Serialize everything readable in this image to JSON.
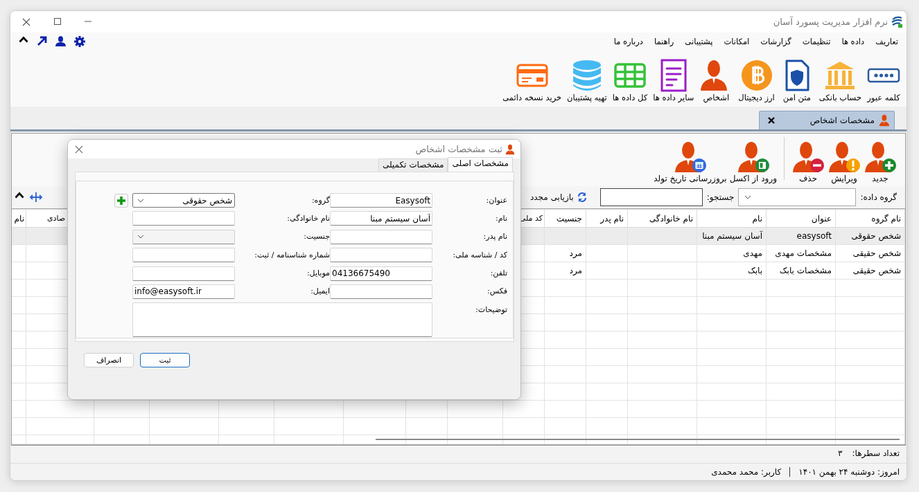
{
  "window": {
    "title": "نرم افزار مدیریت پسورد آسان"
  },
  "menu": [
    "تعاریف",
    "داده ها",
    "تنظیمات",
    "گزارشات",
    "امکانات",
    "پشتیبانی",
    "راهنما",
    "درباره ما"
  ],
  "ribbon": [
    {
      "label": "کلمه عبور",
      "kind": "password"
    },
    {
      "label": "حساب بانکی",
      "kind": "bank"
    },
    {
      "label": "متن امن",
      "kind": "secure"
    },
    {
      "label": "ارز دیجیتال",
      "kind": "coin"
    },
    {
      "label": "اشخاص",
      "kind": "person"
    },
    {
      "label": "سایر داده ها",
      "kind": "document"
    },
    {
      "label": "کل داده ها",
      "kind": "table"
    },
    {
      "label": "تهیه پشتیبان",
      "kind": "database"
    },
    {
      "label": "خرید نسخه دائمی",
      "kind": "card"
    }
  ],
  "document_tabs": [
    {
      "label": "مشخصات اشخاص",
      "selected": true
    }
  ],
  "toolbar": {
    "groups": [
      {
        "buttons": [
          {
            "label": "جدید",
            "kind": "add"
          },
          {
            "label": "ویرایش",
            "kind": "edit"
          },
          {
            "label": "حذف",
            "kind": "delete"
          }
        ]
      },
      {
        "buttons": [
          {
            "label": "ورود از اکسل",
            "kind": "excel"
          },
          {
            "label": "بروزرسانی تاریخ تولد",
            "kind": "calendar"
          }
        ]
      }
    ]
  },
  "filter": {
    "group_label": "گروه داده:",
    "search_label": "جستجو:",
    "refresh_button": "بازیابی مجدد"
  },
  "table": {
    "columns": [
      "نام گروه",
      "عنوان",
      "نام",
      "نام خانوادگی",
      "نام پدر",
      "جنسیت",
      "کد ملی",
      "صادی",
      "نام"
    ],
    "rows": [
      {
        "group": "شخص حقوقی",
        "title": "easysoft",
        "name": "آسان سیستم مبنا",
        "selected": true
      },
      {
        "group": "شخص حقیقی",
        "title": "مشخصات مهدی",
        "name": "مهدی",
        "gender": "مرد",
        "selected": false
      },
      {
        "group": "شخص حقیقی",
        "title": "مشخصات بابک",
        "name": "بابک",
        "gender": "مرد",
        "selected": false
      }
    ]
  },
  "row_count": {
    "label": "تعداد سطرها:",
    "value": "۳"
  },
  "status_bar": {
    "date": "امروز: دوشنبه ۲۴ بهمن ۱۴۰۱",
    "user": "کاربر: محمد محمدی"
  },
  "dialog": {
    "title": "ثبت مشخصات اشخاص",
    "tabs": [
      {
        "label": "مشخصات اصلی",
        "selected": true
      },
      {
        "label": "مشخصات تکمیلی",
        "selected": false
      }
    ],
    "fields": [
      {
        "label": "عنوان:",
        "kind": "text",
        "value": "Easysoft"
      },
      {
        "label": "گروه:",
        "kind": "combo",
        "value": "شخص حقوقی",
        "disabled": false,
        "add_button": true
      },
      {
        "label": "نام:",
        "kind": "text",
        "value": "آسان سیستم مبنا"
      },
      {
        "label": "نام خانوادگی:",
        "kind": "text"
      },
      {
        "label": "نام پدر:",
        "kind": "text"
      },
      {
        "label": "جنسیت:",
        "kind": "combo",
        "disabled": true
      },
      {
        "label": "کد / شناسه ملی:",
        "kind": "text"
      },
      {
        "label": "شماره شناسنامه / ثبت:",
        "kind": "text"
      },
      {
        "label": "تلفن:",
        "kind": "text",
        "value": "04136675490"
      },
      {
        "label": "موبایل:",
        "kind": "text"
      },
      {
        "label": "فکس:",
        "kind": "text"
      },
      {
        "label": "ایمیل:",
        "kind": "text",
        "value": "info@easysoft.ir"
      },
      {
        "label": "توضیحات:",
        "kind": "textarea"
      }
    ],
    "buttons": [
      {
        "label": "ثبت",
        "default": true
      },
      {
        "label": "انصراف",
        "default": false
      }
    ]
  }
}
